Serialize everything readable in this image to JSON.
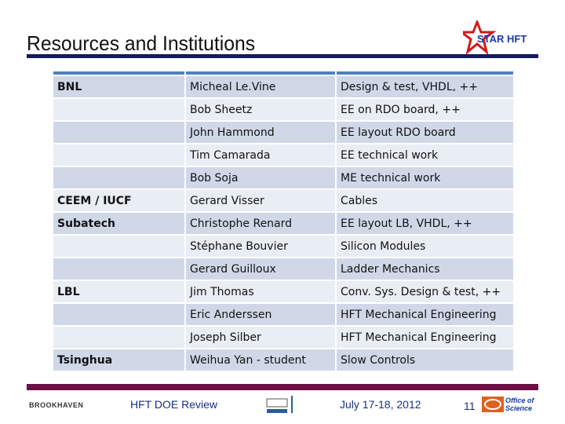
{
  "title": "Resources and Institutions",
  "logo_text": "STAR HFT",
  "rows": [
    {
      "inst": "BNL",
      "person": "Micheal Le.Vine",
      "role": "Design & test, VHDL, ++"
    },
    {
      "inst": "",
      "person": "Bob Sheetz",
      "role": "EE on RDO board, ++"
    },
    {
      "inst": "",
      "person": "John Hammond",
      "role": "EE layout RDO board"
    },
    {
      "inst": "",
      "person": "Tim Camarada",
      "role": "EE technical work"
    },
    {
      "inst": "",
      "person": "Bob Soja",
      "role": "ME technical work"
    },
    {
      "inst": "CEEM / IUCF",
      "person": "Gerard Visser",
      "role": "Cables"
    },
    {
      "inst": "Subatech",
      "person": "Christophe Renard",
      "role": "EE layout LB, VHDL, ++"
    },
    {
      "inst": "",
      "person": "Stéphane Bouvier",
      "role": "Silicon Modules"
    },
    {
      "inst": "",
      "person": "Gerard Guilloux",
      "role": "Ladder Mechanics"
    },
    {
      "inst": "LBL",
      "person": "Jim Thomas",
      "role": "Conv.  Sys. Design & test, ++"
    },
    {
      "inst": "",
      "person": "Eric Anderssen",
      "role": "HFT Mechanical Engineering"
    },
    {
      "inst": "",
      "person": "Joseph Silber",
      "role": "HFT Mechanical Engineering"
    },
    {
      "inst": "Tsinghua",
      "person": "Weihua Yan - student",
      "role": "Slow Controls"
    }
  ],
  "footer": {
    "bnl_logo": "BROOKHAVEN",
    "review": "HFT DOE Review",
    "date": "July 17-18, 2012",
    "page": "11",
    "oos_logo": "Office of Science"
  }
}
